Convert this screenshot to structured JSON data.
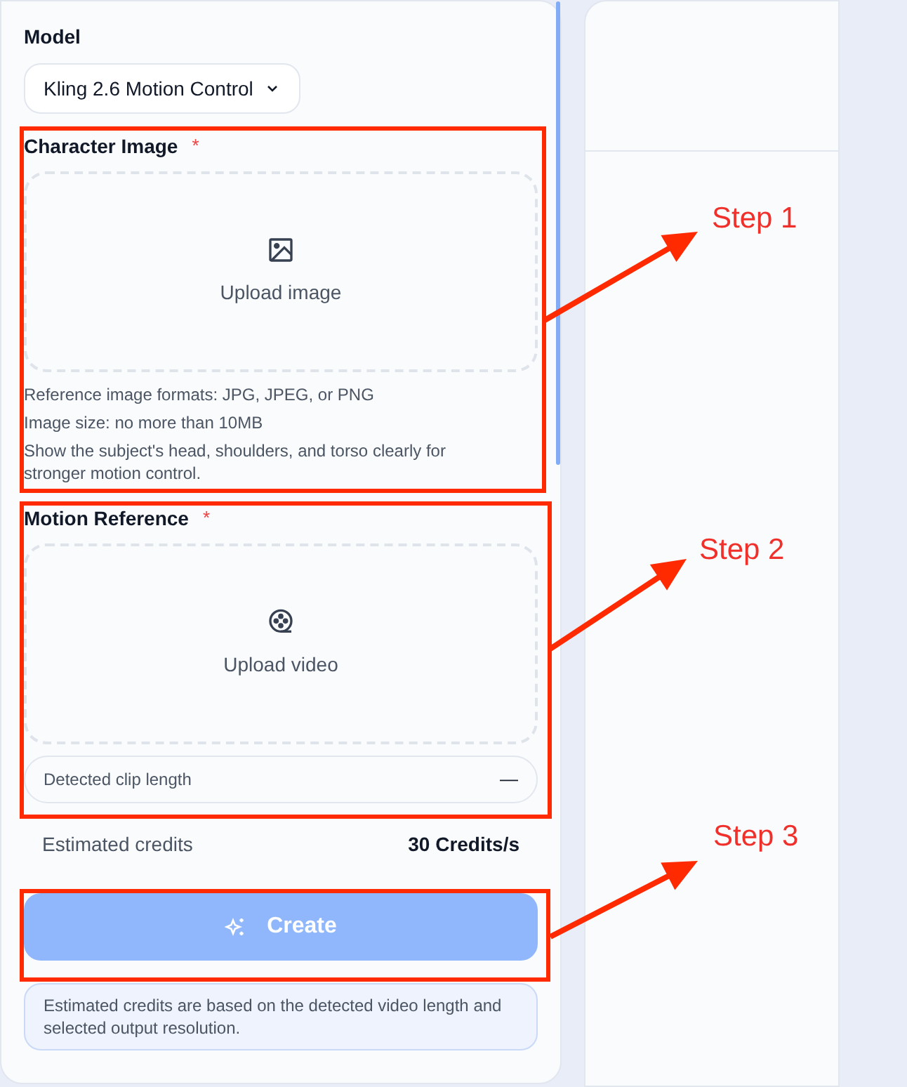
{
  "form": {
    "model_label": "Model",
    "model_value": "Kling 2.6 Motion Control",
    "sections": [
      {
        "label": "Character Image",
        "required_mark": "*",
        "kind": "image",
        "upload_text": "Upload image",
        "hints": [
          "Reference image formats: JPG, JPEG, or PNG",
          "Image size: no more than 10MB",
          "Show the subject's head, shoulders, and torso clearly for stronger motion control."
        ]
      },
      {
        "label": "Motion Reference",
        "required_mark": "*",
        "kind": "video",
        "upload_text": "Upload video",
        "clip_label": "Detected clip length",
        "clip_value": "—"
      }
    ],
    "credits_label": "Estimated credits",
    "credits_value": "30 Credits/s",
    "create_button": {
      "label": "Create",
      "disabled": true
    },
    "note": "Estimated credits are based on the detected video length and selected output resolution."
  },
  "annotations": [
    {
      "label": "Step 1"
    },
    {
      "label": "Step 2"
    },
    {
      "label": "Step 3"
    }
  ]
}
